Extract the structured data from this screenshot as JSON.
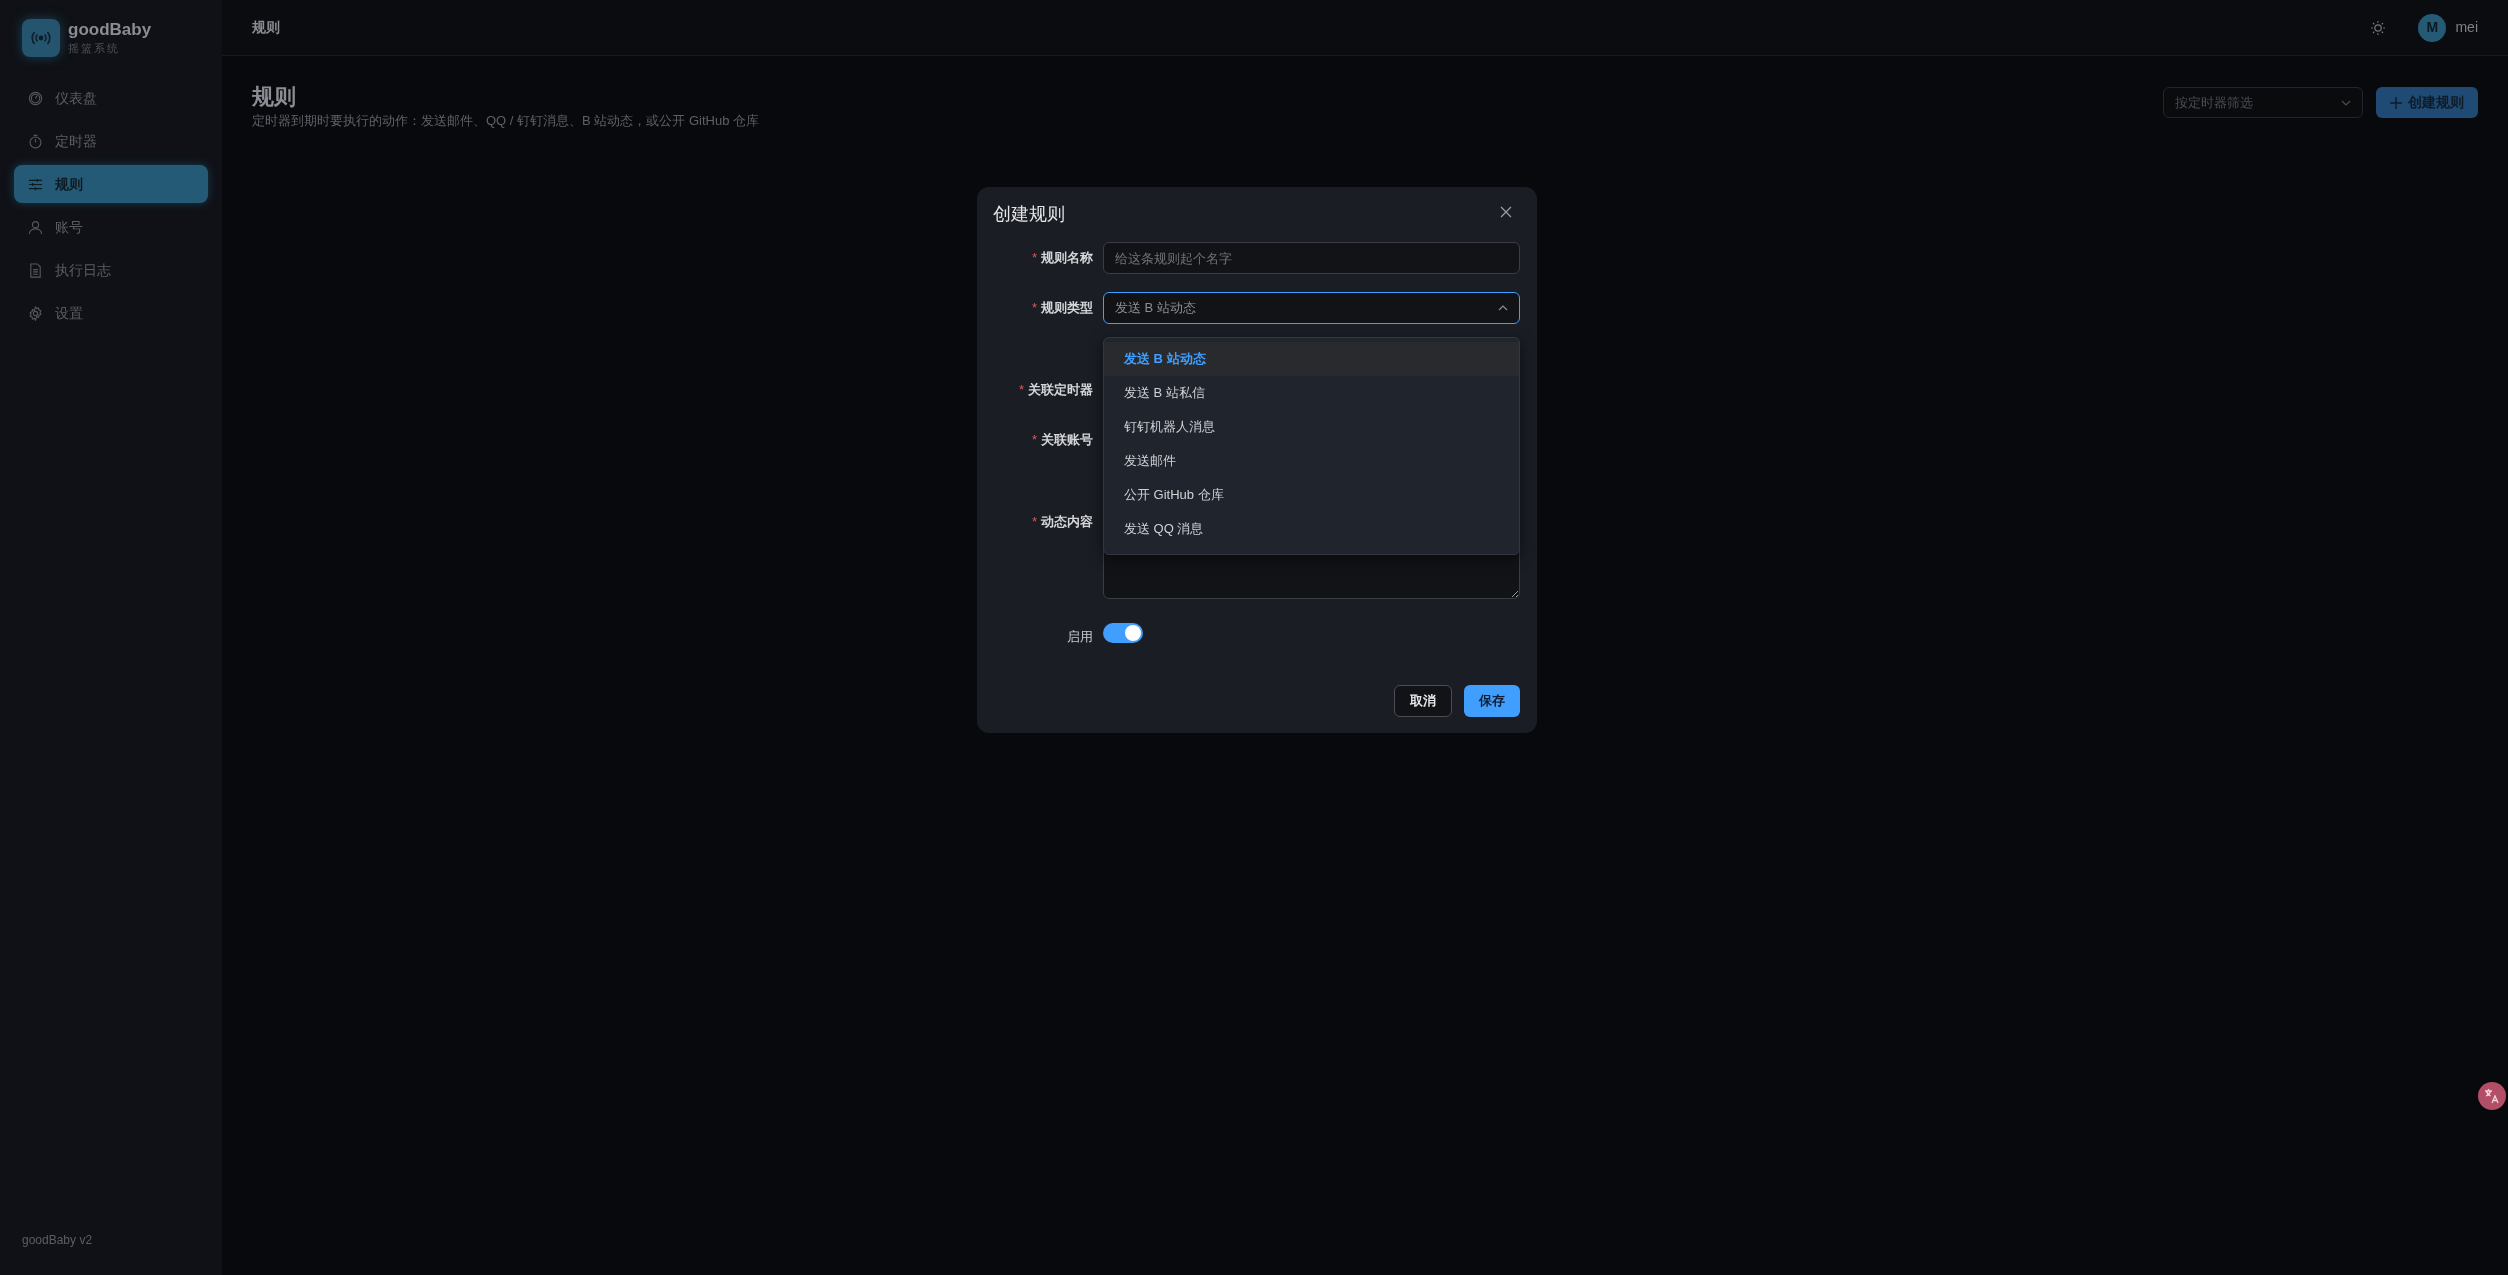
{
  "sidebar": {
    "logo": {
      "title": "goodBaby",
      "subtitle": "摇篮系统"
    },
    "items": [
      {
        "label": "仪表盘",
        "selected": false
      },
      {
        "label": "定时器",
        "selected": false
      },
      {
        "label": "规则",
        "selected": true
      },
      {
        "label": "账号",
        "selected": false
      },
      {
        "label": "执行日志",
        "selected": false
      },
      {
        "label": "设置",
        "selected": false
      }
    ],
    "footer": "goodBaby v2"
  },
  "header": {
    "breadcrumb": "规则",
    "user": {
      "initial": "M",
      "name": "mei"
    }
  },
  "page": {
    "title": "规则",
    "description": "定时器到期时要执行的动作：发送邮件、QQ / 钉钉消息、B 站动态，或公开 GitHub 仓库",
    "filter": {
      "placeholder": "按定时器筛选"
    },
    "create_button": "创建规则"
  },
  "dialog": {
    "title": "创建规则",
    "required_mark": "*",
    "fields": [
      {
        "kind": "input",
        "label": "规则名称",
        "required": true,
        "placeholder": "给这条规则起个名字"
      },
      {
        "kind": "select",
        "label": "规则类型",
        "required": true,
        "value": "发送 B 站动态",
        "expanded": true,
        "options": [
          {
            "label": "发送 B 站动态",
            "selected": true
          },
          {
            "label": "发送 B 站私信",
            "selected": false
          },
          {
            "label": "钉钉机器人消息",
            "selected": false
          },
          {
            "label": "发送邮件",
            "selected": false
          },
          {
            "label": "公开 GitHub 仓库",
            "selected": false
          },
          {
            "label": "发送 QQ 消息",
            "selected": false
          }
        ]
      },
      {
        "kind": "covered",
        "label": "关联定时器",
        "required": true
      },
      {
        "kind": "covered",
        "label": "关联账号",
        "required": true
      },
      {
        "kind": "textarea",
        "label": "动态内容",
        "required": true
      },
      {
        "kind": "switch",
        "label": "启用",
        "required": false,
        "on": true
      }
    ],
    "buttons": [
      {
        "label": "取消",
        "kind": "default"
      },
      {
        "label": "保存",
        "kind": "primary"
      }
    ]
  }
}
